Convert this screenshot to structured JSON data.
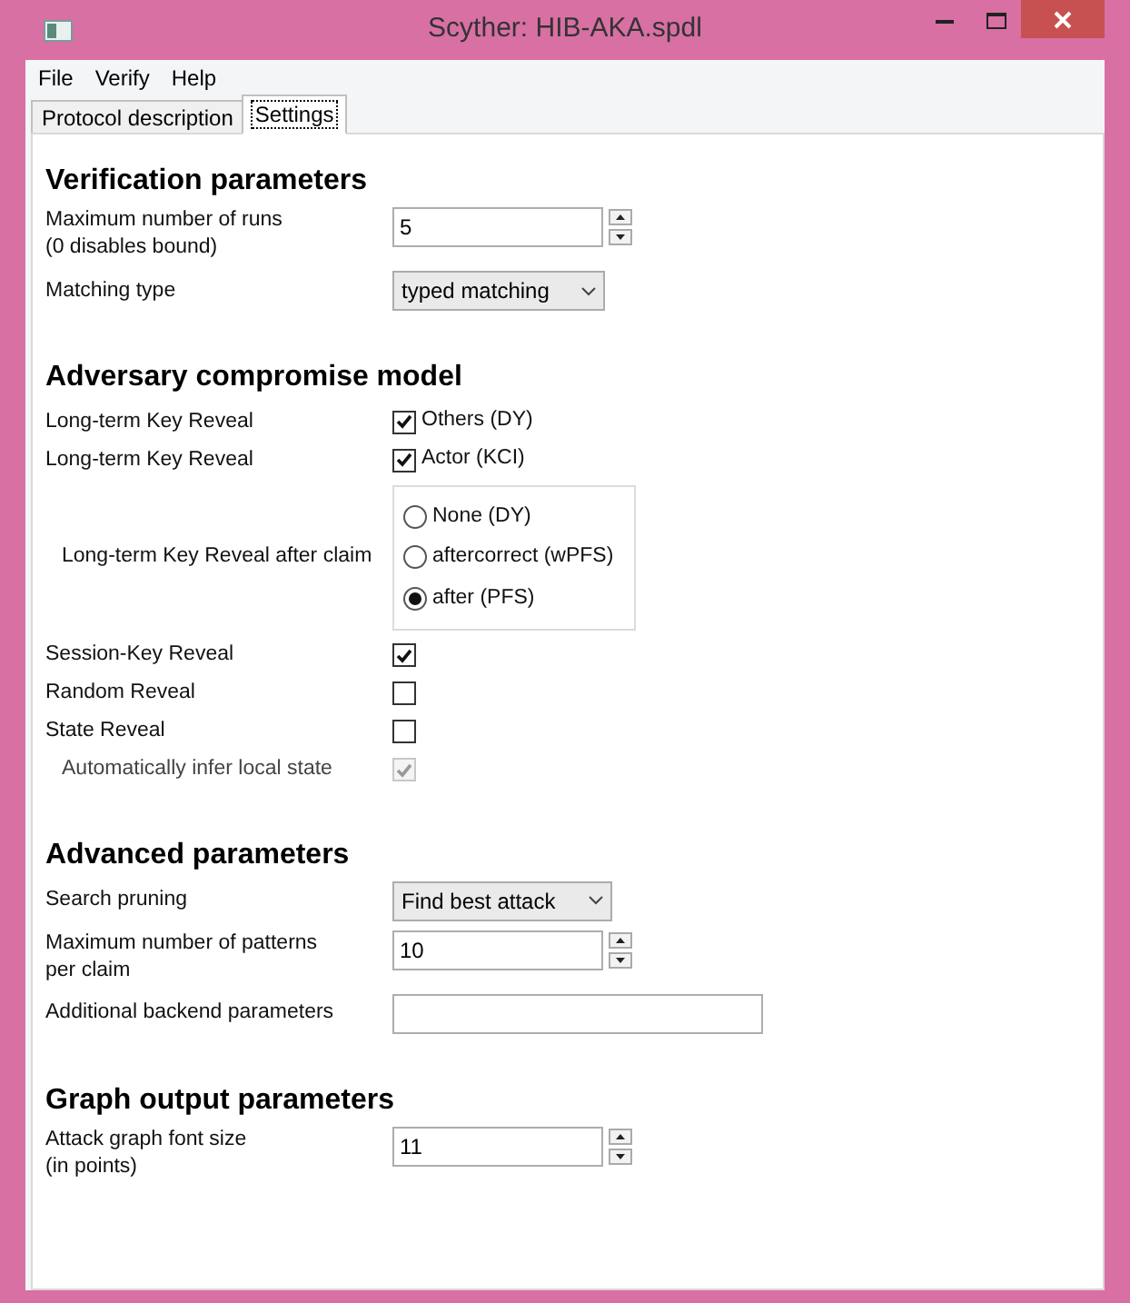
{
  "window": {
    "title": "Scyther: HIB-AKA.spdl"
  },
  "menu": [
    "File",
    "Verify",
    "Help"
  ],
  "tabs": [
    {
      "label": "Protocol description",
      "selected": false
    },
    {
      "label": "Settings",
      "selected": true
    }
  ],
  "sections": [
    {
      "title": "Verification parameters",
      "rows": [
        {
          "kind": "spin",
          "label": [
            "Maximum number of runs",
            "(0 disables bound)"
          ],
          "value": "5"
        },
        {
          "kind": "select",
          "label": [
            "Matching type"
          ],
          "value": "typed matching"
        }
      ]
    },
    {
      "title": "Adversary compromise model",
      "rows": [
        {
          "kind": "check",
          "label": [
            "Long-term Key Reveal"
          ],
          "option": "Others (DY)",
          "checked": true,
          "disabled": false,
          "indented": false
        },
        {
          "kind": "check",
          "label": [
            "Long-term Key Reveal"
          ],
          "option": "Actor (KCI)",
          "checked": true,
          "disabled": false,
          "indented": false
        },
        {
          "kind": "radio",
          "label": [
            "Long-term Key Reveal after claim"
          ],
          "options": [
            {
              "label": "None (DY)",
              "selected": false
            },
            {
              "label": "aftercorrect (wPFS)",
              "selected": false
            },
            {
              "label": "after (PFS)",
              "selected": true
            }
          ]
        },
        {
          "kind": "check",
          "label": [
            "Session-Key Reveal"
          ],
          "checked": true,
          "disabled": false,
          "indented": false
        },
        {
          "kind": "check",
          "label": [
            "Random Reveal"
          ],
          "checked": false,
          "disabled": false,
          "indented": false
        },
        {
          "kind": "check",
          "label": [
            "State Reveal"
          ],
          "checked": false,
          "disabled": false,
          "indented": false
        },
        {
          "kind": "check",
          "label": [
            "Automatically infer local state"
          ],
          "checked": true,
          "disabled": true,
          "indented": true
        }
      ]
    },
    {
      "title": "Advanced parameters",
      "rows": [
        {
          "kind": "select",
          "label": [
            "Search pruning"
          ],
          "value": "Find best attack"
        },
        {
          "kind": "spin",
          "label": [
            "Maximum number of patterns",
            "per claim"
          ],
          "value": "10"
        },
        {
          "kind": "text",
          "label": [
            "Additional backend parameters"
          ]
        }
      ]
    },
    {
      "title": "Graph output parameters",
      "rows": [
        {
          "kind": "spin",
          "label": [
            "Attack graph font size",
            "(in points)"
          ],
          "value": "11"
        }
      ]
    }
  ]
}
